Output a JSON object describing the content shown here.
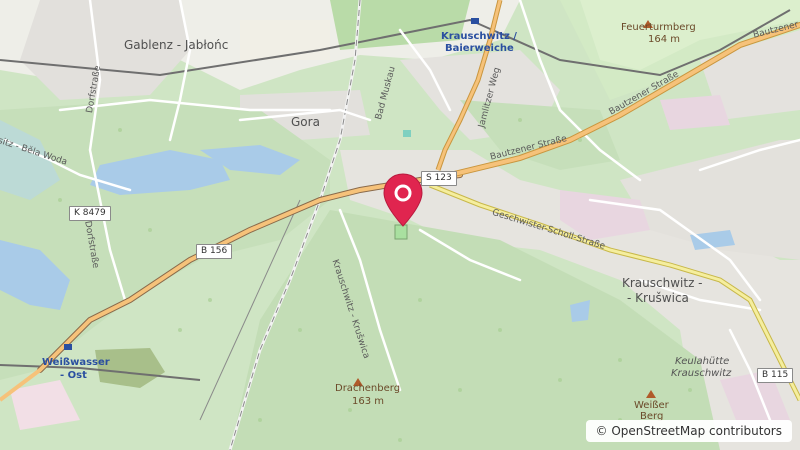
{
  "map": {
    "attribution": "© OpenStreetMap contributors",
    "towns": {
      "gablenz": "Gablenz - Jabłońc",
      "gora": "Gora",
      "krauschwitz_line1": "Krauschwitz -",
      "krauschwitz_line2": "- Krušwica"
    },
    "stations": {
      "krauschwitz_line1": "Krauschwitz /",
      "krauschwitz_line2": "Baierweiche",
      "weisswasser_line1": "Weißwasser",
      "weisswasser_line2": "- Ost"
    },
    "peaks": {
      "feuerturmberg_name": "Feuerturmberg",
      "feuerturmberg_height": "164 m",
      "drachenberg_name": "Drachenberg",
      "drachenberg_height": "163 m",
      "weisser_berg_line1": "Weißer",
      "weisser_berg_line2": "Berg"
    },
    "places": {
      "keulahuette_line1": "Keulahütte",
      "keulahuette_line2": "Krauschwitz"
    },
    "streets": {
      "bautzener_1": "Bautzener Straße",
      "bautzener_2": "Bautzener Straße",
      "bautzener_3": "Bautzener Straße",
      "geschwister": "Geschwister-Scholl-Straße",
      "dorfstrasse_1": "Dorfstraße",
      "dorfstrasse_2": "Dorfstraße",
      "jamlitzer": "Jamlitzer Weg",
      "bad_muskau": "Bad Muskau",
      "krauschwitz_path": "Krauschwitz - Krušwica",
      "bela_woda": "sitz - Běla Woda"
    },
    "shields": {
      "s123": "S 123",
      "k8479": "K 8479",
      "b156": "B 156",
      "b115": "B 115"
    }
  }
}
